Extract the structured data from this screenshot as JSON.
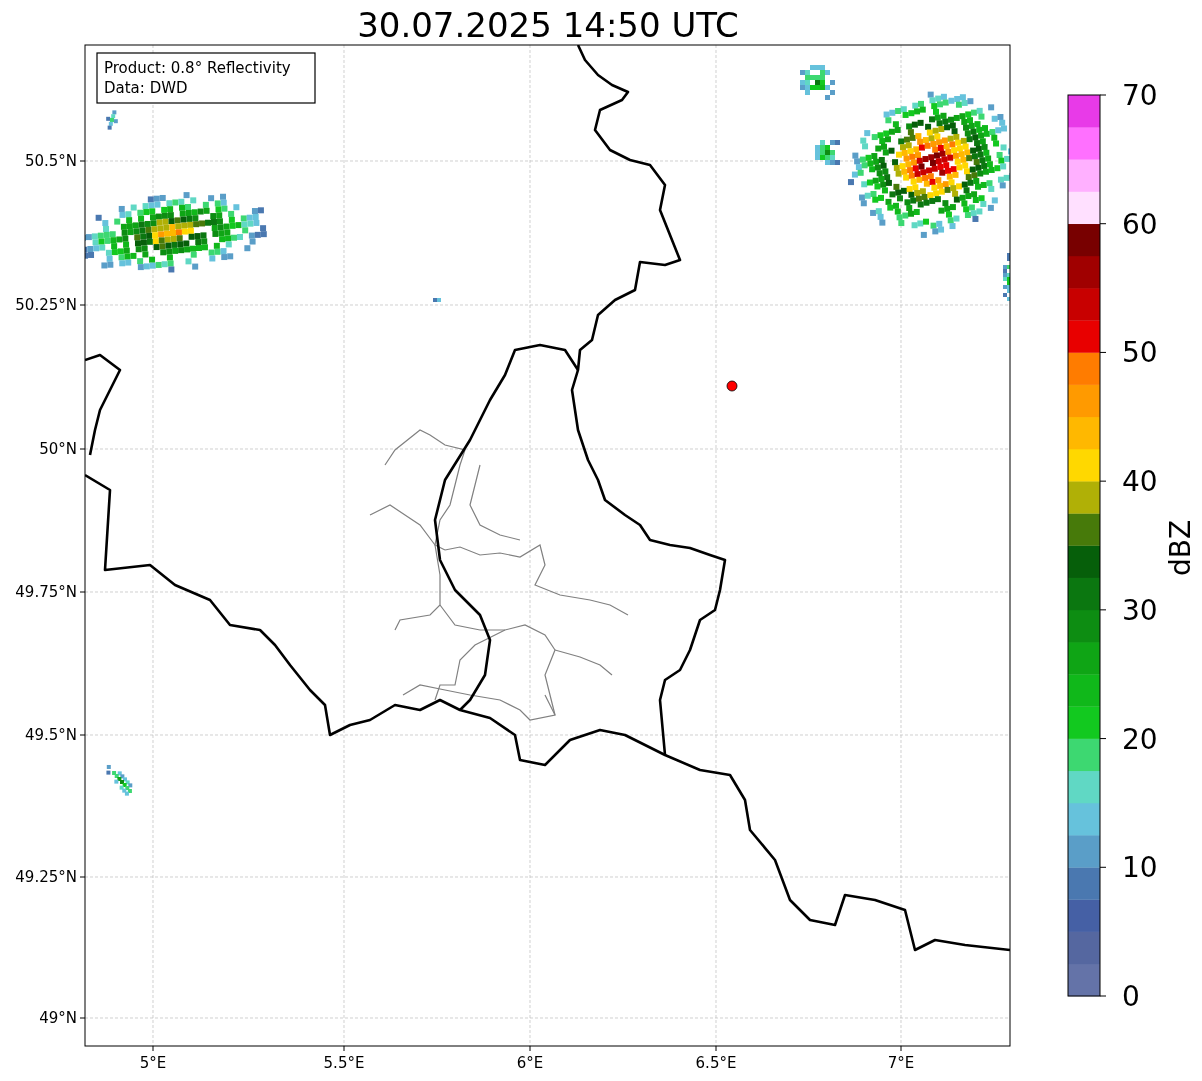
{
  "title": "30.07.2025 14:50 UTC",
  "info_box": [
    "Product: 0.8° Reflectivity",
    "Data: DWD"
  ],
  "x_axis": {
    "ticks": [
      "5°E",
      "5.5°E",
      "6°E",
      "6.5°E",
      "7°E"
    ]
  },
  "y_axis": {
    "ticks": [
      "50.5°N",
      "50.25°N",
      "50°N",
      "49.75°N",
      "49.5°N",
      "49.25°N",
      "49°N"
    ]
  },
  "colorbar": {
    "label": "dBZ",
    "ticks": [
      "70",
      "60",
      "50",
      "40",
      "30",
      "20",
      "10",
      "0"
    ],
    "bins": [
      {
        "color": "#6473a8"
      },
      {
        "color": "#5567a0"
      },
      {
        "color": "#4560a5"
      },
      {
        "color": "#4a78b0"
      },
      {
        "color": "#5a9ec8"
      },
      {
        "color": "#66c2dc"
      },
      {
        "color": "#60d8c4"
      },
      {
        "color": "#3dd871"
      },
      {
        "color": "#12c91f"
      },
      {
        "color": "#10b81a"
      },
      {
        "color": "#0fa515"
      },
      {
        "color": "#0d8d12"
      },
      {
        "color": "#0b7710"
      },
      {
        "color": "#065f0a"
      },
      {
        "color": "#477a0a"
      },
      {
        "color": "#b0b006"
      },
      {
        "color": "#ffd800"
      },
      {
        "color": "#ffb800"
      },
      {
        "color": "#ff9a00"
      },
      {
        "color": "#ff7c00"
      },
      {
        "color": "#e80000"
      },
      {
        "color": "#c80000"
      },
      {
        "color": "#a00000"
      },
      {
        "color": "#780000"
      },
      {
        "color": "#ffe0ff"
      },
      {
        "color": "#ffb0ff"
      },
      {
        "color": "#ff70ff"
      },
      {
        "color": "#e83ae8"
      }
    ]
  }
}
